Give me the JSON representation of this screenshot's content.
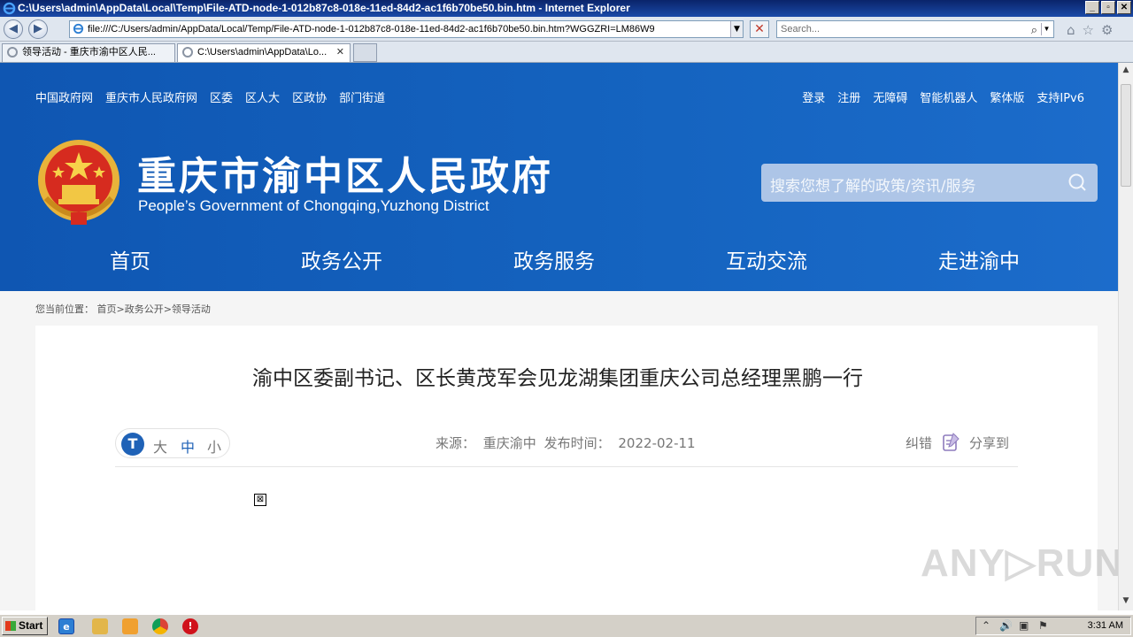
{
  "window": {
    "title": "C:\\Users\\admin\\AppData\\Local\\Temp\\File-ATD-node-1-012b87c8-018e-11ed-84d2-ac1f6b70be50.bin.htm - Internet Explorer",
    "minimize": "_",
    "maximize": "▫",
    "close": "✕"
  },
  "addressbar": {
    "back": "◀",
    "forward": "▶",
    "url": "file:///C:/Users/admin/AppData/Local/Temp/File-ATD-node-1-012b87c8-018e-11ed-84d2-ac1f6b70be50.bin.htm?WGGZRI=LM86W9",
    "dropdown": "▼",
    "stop": "✕",
    "search_placeholder": "Search...",
    "search_icon": "⌕",
    "search_drop": "▼",
    "home_icon": "⌂",
    "favorites_icon": "☆",
    "tools_icon": "⚙"
  },
  "tabs": [
    {
      "label": "领导活动 - 重庆市渝中区人民...",
      "active": false
    },
    {
      "label": "C:\\Users\\admin\\AppData\\Lo...",
      "active": true,
      "close": "✕"
    }
  ],
  "site": {
    "top_links_left": [
      "中国政府网",
      "重庆市人民政府网",
      "区委",
      "区人大",
      "区政协",
      "部门街道"
    ],
    "top_links_right": [
      "登录",
      "注册",
      "无障碍",
      "智能机器人",
      "繁体版",
      "支持IPv6"
    ],
    "title": "重庆市渝中区人民政府",
    "subtitle": "People’s Government of Chongqing,Yuzhong District",
    "search_placeholder": "搜索您想了解的政策/资讯/服务",
    "nav": [
      "首页",
      "政务公开",
      "政务服务",
      "互动交流",
      "走进渝中"
    ],
    "brand_color": "#1564c0"
  },
  "breadcrumb": {
    "prefix": "您当前位置：",
    "path": "首页>政务公开>领导活动"
  },
  "article": {
    "title": "渝中区委副书记、区长黄茂军会见龙湖集团重庆公司总经理黑鹏一行",
    "font_icon": "T",
    "font_sizes": [
      "大",
      "中",
      "小"
    ],
    "source_label": "来源：",
    "source": "重庆渝中",
    "time_label": "发布时间：",
    "time": "2022-02-11",
    "correction": "纠错",
    "share": "分享到",
    "broken_image": "⊠"
  },
  "watermark": "ANY▷RUN",
  "scrollbar": {
    "up": "▲",
    "down": "▼"
  },
  "taskbar": {
    "start": "Start",
    "tray_icons": [
      "⌃",
      "🔊",
      "▣",
      "⚑"
    ],
    "clock": "3:31 AM"
  }
}
